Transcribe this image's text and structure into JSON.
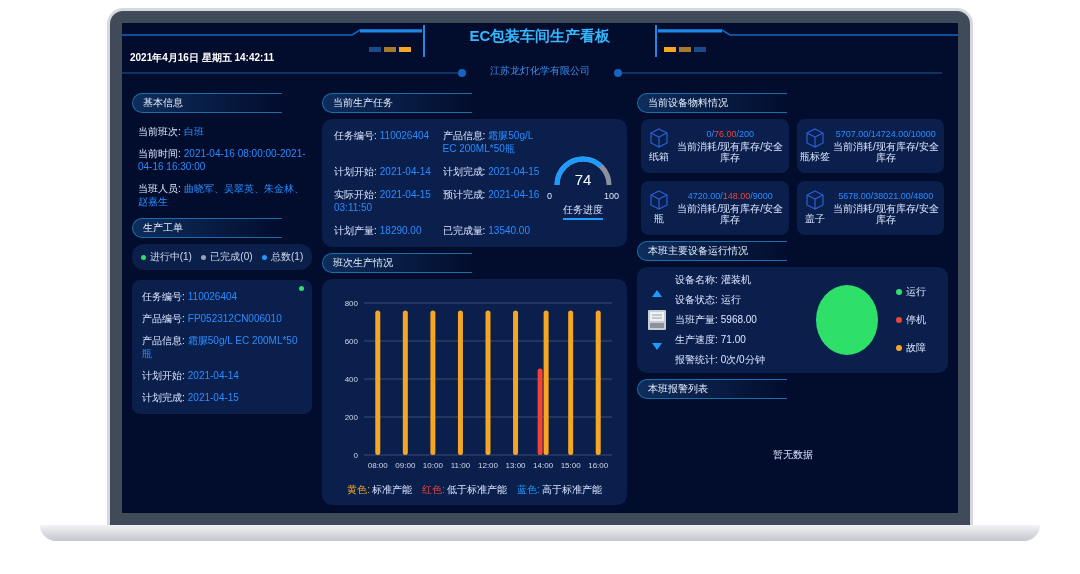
{
  "header": {
    "datetime": "2021年4月16日 星期五 14:42:11",
    "title": "EC包装车间生产看板",
    "company": "江苏龙灯化学有限公司"
  },
  "basic_info": {
    "title": "基本信息",
    "fields": [
      {
        "label": "当前班次:",
        "value": "白班"
      },
      {
        "label": "当前时间:",
        "value": "2021-04-16 08:00:00-2021-04-16 16:30:00"
      },
      {
        "label": "当班人员:",
        "value": "曲晓军、吴翠英、朱金林、赵嘉生"
      }
    ]
  },
  "work_orders": {
    "title": "生产工单",
    "filters": [
      {
        "label": "进行中(1)",
        "color": "#2ee06a"
      },
      {
        "label": "已完成(0)",
        "color": "#9aa3b5"
      },
      {
        "label": "总数(1)",
        "color": "#1e9bff"
      }
    ],
    "orders": [
      {
        "color": "#2ee06a",
        "fields": [
          {
            "label": "任务编号:",
            "value": "110026404"
          },
          {
            "label": "产品编号:",
            "value": "FP052312CN006010"
          },
          {
            "label": "产品信息:",
            "value": "霜脲50g/L EC 200ML*50瓶"
          },
          {
            "label": "计划开始:",
            "value": "2021-04-14"
          },
          {
            "label": "计划完成:",
            "value": "2021-04-15"
          }
        ]
      }
    ]
  },
  "current_task": {
    "title": "当前生产任务",
    "fields": [
      {
        "label": "任务编号:",
        "value": "110026404"
      },
      {
        "label": "产品信息:",
        "value": "霜脲50g/L EC 200ML*50瓶"
      },
      {
        "label": "计划开始:",
        "value": "2021-04-14"
      },
      {
        "label": "计划完成:",
        "value": "2021-04-15"
      },
      {
        "label": "实际开始:",
        "value": "2021-04-15 03:11:50"
      },
      {
        "label": "预计完成:",
        "value": "2021-04-16"
      },
      {
        "label": "计划产量:",
        "value": "18290.00"
      },
      {
        "label": "已完成量:",
        "value": "13540.00"
      }
    ],
    "progress": {
      "value": "74",
      "min": "0",
      "max": "100",
      "label": "任务进度"
    }
  },
  "shift_production": {
    "title": "班次生产情况",
    "chart_data": {
      "type": "bar",
      "categories": [
        "08:00",
        "09:00",
        "10:00",
        "11:00",
        "12:00",
        "13:00",
        "14:00",
        "15:00",
        "16:00"
      ],
      "series": [
        {
          "name": "标准产能",
          "color": "#f5a623",
          "values": [
            760,
            760,
            760,
            760,
            760,
            760,
            760,
            760,
            760
          ]
        },
        {
          "name": "低于标准产能",
          "color": "#f0443a",
          "values": [
            null,
            null,
            null,
            null,
            null,
            null,
            455,
            null,
            null
          ]
        },
        {
          "name": "高于标准产能",
          "color": "#1e9bff",
          "values": [
            null,
            null,
            null,
            null,
            null,
            null,
            null,
            null,
            null
          ]
        }
      ],
      "ylim": [
        0,
        800
      ],
      "yticks": [
        0,
        200,
        400,
        600,
        800
      ],
      "grid": true
    },
    "legend_keys": [
      "黄色:",
      "红色:",
      "蓝色:"
    ]
  },
  "materials": {
    "title": "当前设备物料情况",
    "items": [
      {
        "name": "纸箱",
        "consumed": "0/",
        "stock": "76.00",
        "safety": "/200",
        "low": true,
        "caption": "当前消耗/现有库存/安全库存"
      },
      {
        "name": "瓶标签",
        "consumed": "5707.00/",
        "stock": "14724.00",
        "safety": "/10000",
        "low": false,
        "caption": "当前消耗/现有库存/安全库存"
      },
      {
        "name": "瓶",
        "consumed": "4720.00/",
        "stock": "148.00",
        "safety": "/9000",
        "low": true,
        "caption": "当前消耗/现有库存/安全库存"
      },
      {
        "name": "盖子",
        "consumed": "5678.00/",
        "stock": "38021.00",
        "safety": "/4800",
        "low": false,
        "caption": "当前消耗/现有库存/安全库存"
      }
    ]
  },
  "equipment": {
    "title": "本班主要设备运行情况",
    "fields": [
      {
        "label": "设备名称:",
        "value": "灌装机"
      },
      {
        "label": "设备状态:",
        "value": "运行"
      },
      {
        "label": "当班产量:",
        "value": "5968.00"
      },
      {
        "label": "生产速度:",
        "value": "71.00"
      },
      {
        "label": "报警统计:",
        "value": "0次/0分钟"
      }
    ],
    "legend": [
      {
        "label": "运行",
        "color": "#2ee06a"
      },
      {
        "label": "停机",
        "color": "#f0443a"
      },
      {
        "label": "故障",
        "color": "#f5a623"
      }
    ]
  },
  "alarms": {
    "title": "本班报警列表",
    "empty_text": "暂无数据"
  }
}
